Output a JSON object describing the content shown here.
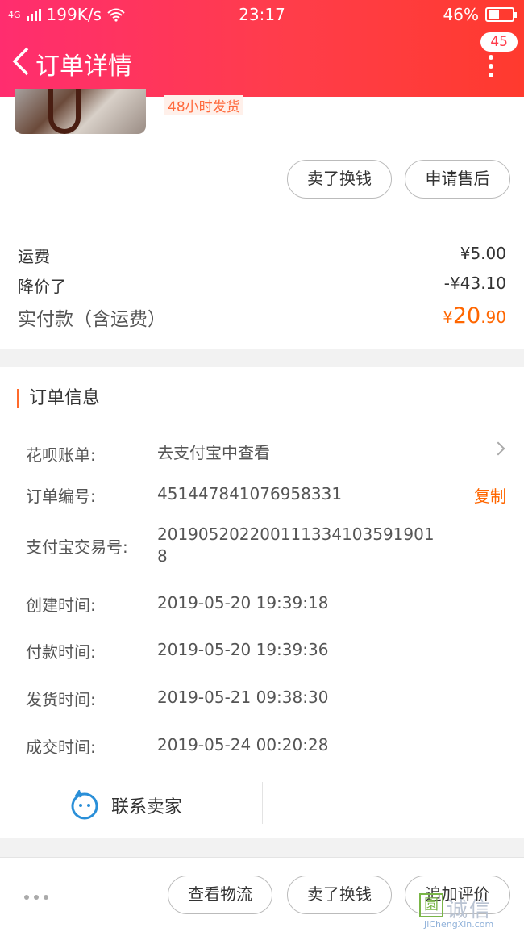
{
  "status_bar": {
    "network": "4G",
    "speed": "199K/s",
    "time": "23:17",
    "battery": "46%"
  },
  "header": {
    "title": "订单详情",
    "notification_count": "45"
  },
  "product": {
    "shipping_tag": "48小时发货"
  },
  "actions_top": {
    "sell_label": "卖了换钱",
    "after_sale_label": "申请售后"
  },
  "price_summary": {
    "shipping_label": "运费",
    "shipping_value": "¥5.00",
    "discount_label": "降价了",
    "discount_value": "-¥43.10",
    "paid_label": "实付款（含运费）",
    "paid_currency": "¥",
    "paid_int": "20",
    "paid_dec": ".90"
  },
  "order_info": {
    "section_title": "订单信息",
    "huabei_label": "花呗账单:",
    "huabei_value": "去支付宝中查看",
    "order_no_label": "订单编号:",
    "order_no_value": "451447841076958331",
    "copy_label": "复制",
    "alipay_label": "支付宝交易号:",
    "alipay_value": "2019052022001113341035919018",
    "created_label": "创建时间:",
    "created_value": "2019-05-20 19:39:18",
    "paid_time_label": "付款时间:",
    "paid_time_value": "2019-05-20 19:39:36",
    "shipped_label": "发货时间:",
    "shipped_value": "2019-05-21 09:38:30",
    "closed_label": "成交时间:",
    "closed_value": "2019-05-24 00:20:28",
    "contact_label": "联系卖家"
  },
  "bottom_bar": {
    "logistics_label": "查看物流",
    "sell_label": "卖了换钱",
    "review_label": "追加评价"
  },
  "watermark": {
    "cn": "诚信",
    "en": "JiChengXin.com"
  }
}
